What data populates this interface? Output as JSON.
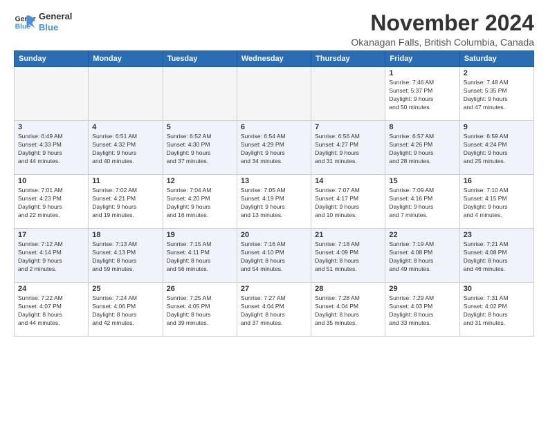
{
  "header": {
    "logo_line1": "General",
    "logo_line2": "Blue",
    "month_title": "November 2024",
    "location": "Okanagan Falls, British Columbia, Canada"
  },
  "weekdays": [
    "Sunday",
    "Monday",
    "Tuesday",
    "Wednesday",
    "Thursday",
    "Friday",
    "Saturday"
  ],
  "weeks": [
    [
      {
        "day": "",
        "info": "",
        "empty": true
      },
      {
        "day": "",
        "info": "",
        "empty": true
      },
      {
        "day": "",
        "info": "",
        "empty": true
      },
      {
        "day": "",
        "info": "",
        "empty": true
      },
      {
        "day": "",
        "info": "",
        "empty": true
      },
      {
        "day": "1",
        "info": "Sunrise: 7:46 AM\nSunset: 5:37 PM\nDaylight: 9 hours\nand 50 minutes.",
        "empty": false
      },
      {
        "day": "2",
        "info": "Sunrise: 7:48 AM\nSunset: 5:35 PM\nDaylight: 9 hours\nand 47 minutes.",
        "empty": false
      }
    ],
    [
      {
        "day": "3",
        "info": "Sunrise: 6:49 AM\nSunset: 4:33 PM\nDaylight: 9 hours\nand 44 minutes.",
        "empty": false
      },
      {
        "day": "4",
        "info": "Sunrise: 6:51 AM\nSunset: 4:32 PM\nDaylight: 9 hours\nand 40 minutes.",
        "empty": false
      },
      {
        "day": "5",
        "info": "Sunrise: 6:52 AM\nSunset: 4:30 PM\nDaylight: 9 hours\nand 37 minutes.",
        "empty": false
      },
      {
        "day": "6",
        "info": "Sunrise: 6:54 AM\nSunset: 4:29 PM\nDaylight: 9 hours\nand 34 minutes.",
        "empty": false
      },
      {
        "day": "7",
        "info": "Sunrise: 6:56 AM\nSunset: 4:27 PM\nDaylight: 9 hours\nand 31 minutes.",
        "empty": false
      },
      {
        "day": "8",
        "info": "Sunrise: 6:57 AM\nSunset: 4:26 PM\nDaylight: 9 hours\nand 28 minutes.",
        "empty": false
      },
      {
        "day": "9",
        "info": "Sunrise: 6:59 AM\nSunset: 4:24 PM\nDaylight: 9 hours\nand 25 minutes.",
        "empty": false
      }
    ],
    [
      {
        "day": "10",
        "info": "Sunrise: 7:01 AM\nSunset: 4:23 PM\nDaylight: 9 hours\nand 22 minutes.",
        "empty": false
      },
      {
        "day": "11",
        "info": "Sunrise: 7:02 AM\nSunset: 4:21 PM\nDaylight: 9 hours\nand 19 minutes.",
        "empty": false
      },
      {
        "day": "12",
        "info": "Sunrise: 7:04 AM\nSunset: 4:20 PM\nDaylight: 9 hours\nand 16 minutes.",
        "empty": false
      },
      {
        "day": "13",
        "info": "Sunrise: 7:05 AM\nSunset: 4:19 PM\nDaylight: 9 hours\nand 13 minutes.",
        "empty": false
      },
      {
        "day": "14",
        "info": "Sunrise: 7:07 AM\nSunset: 4:17 PM\nDaylight: 9 hours\nand 10 minutes.",
        "empty": false
      },
      {
        "day": "15",
        "info": "Sunrise: 7:09 AM\nSunset: 4:16 PM\nDaylight: 9 hours\nand 7 minutes.",
        "empty": false
      },
      {
        "day": "16",
        "info": "Sunrise: 7:10 AM\nSunset: 4:15 PM\nDaylight: 9 hours\nand 4 minutes.",
        "empty": false
      }
    ],
    [
      {
        "day": "17",
        "info": "Sunrise: 7:12 AM\nSunset: 4:14 PM\nDaylight: 9 hours\nand 2 minutes.",
        "empty": false
      },
      {
        "day": "18",
        "info": "Sunrise: 7:13 AM\nSunset: 4:13 PM\nDaylight: 8 hours\nand 59 minutes.",
        "empty": false
      },
      {
        "day": "19",
        "info": "Sunrise: 7:15 AM\nSunset: 4:11 PM\nDaylight: 8 hours\nand 56 minutes.",
        "empty": false
      },
      {
        "day": "20",
        "info": "Sunrise: 7:16 AM\nSunset: 4:10 PM\nDaylight: 8 hours\nand 54 minutes.",
        "empty": false
      },
      {
        "day": "21",
        "info": "Sunrise: 7:18 AM\nSunset: 4:09 PM\nDaylight: 8 hours\nand 51 minutes.",
        "empty": false
      },
      {
        "day": "22",
        "info": "Sunrise: 7:19 AM\nSunset: 4:08 PM\nDaylight: 8 hours\nand 49 minutes.",
        "empty": false
      },
      {
        "day": "23",
        "info": "Sunrise: 7:21 AM\nSunset: 4:08 PM\nDaylight: 8 hours\nand 46 minutes.",
        "empty": false
      }
    ],
    [
      {
        "day": "24",
        "info": "Sunrise: 7:22 AM\nSunset: 4:07 PM\nDaylight: 8 hours\nand 44 minutes.",
        "empty": false
      },
      {
        "day": "25",
        "info": "Sunrise: 7:24 AM\nSunset: 4:06 PM\nDaylight: 8 hours\nand 42 minutes.",
        "empty": false
      },
      {
        "day": "26",
        "info": "Sunrise: 7:25 AM\nSunset: 4:05 PM\nDaylight: 8 hours\nand 39 minutes.",
        "empty": false
      },
      {
        "day": "27",
        "info": "Sunrise: 7:27 AM\nSunset: 4:04 PM\nDaylight: 8 hours\nand 37 minutes.",
        "empty": false
      },
      {
        "day": "28",
        "info": "Sunrise: 7:28 AM\nSunset: 4:04 PM\nDaylight: 8 hours\nand 35 minutes.",
        "empty": false
      },
      {
        "day": "29",
        "info": "Sunrise: 7:29 AM\nSunset: 4:03 PM\nDaylight: 8 hours\nand 33 minutes.",
        "empty": false
      },
      {
        "day": "30",
        "info": "Sunrise: 7:31 AM\nSunset: 4:02 PM\nDaylight: 8 hours\nand 31 minutes.",
        "empty": false
      }
    ]
  ]
}
